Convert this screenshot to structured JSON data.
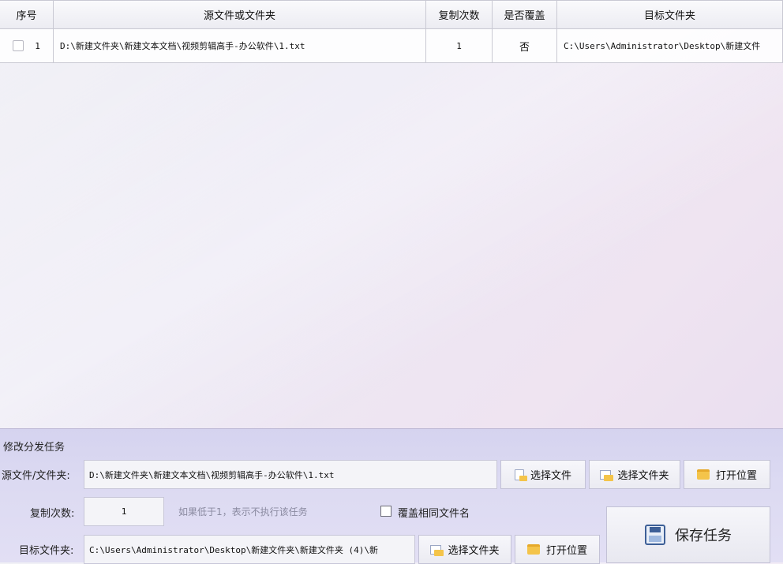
{
  "table": {
    "headers": [
      "序号",
      "源文件或文件夹",
      "复制次数",
      "是否覆盖",
      "目标文件夹"
    ],
    "rows": [
      {
        "index": "1",
        "source": "D:\\新建文件夹\\新建文本文档\\视频剪辑高手-办公软件\\1.txt",
        "copies": "1",
        "overwrite": "否",
        "target": "C:\\Users\\Administrator\\Desktop\\新建文件"
      }
    ]
  },
  "panel": {
    "title": "修改分发任务",
    "source_label": "源文件/文件夹:",
    "source_value": "D:\\新建文件夹\\新建文本文档\\视频剪辑高手-办公软件\\1.txt",
    "select_file": "选择文件",
    "select_folder": "选择文件夹",
    "open_location": "打开位置",
    "copies_label": "复制次数:",
    "copies_value": "1",
    "copies_hint": "如果低于1，表示不执行该任务",
    "overwrite_label": "覆盖相同文件名",
    "target_label": "目标文件夹:",
    "target_value": "C:\\Users\\Administrator\\Desktop\\新建文件夹\\新建文件夹 (4)\\新",
    "target_select_folder": "选择文件夹",
    "target_open_location": "打开位置",
    "save": "保存任务"
  }
}
